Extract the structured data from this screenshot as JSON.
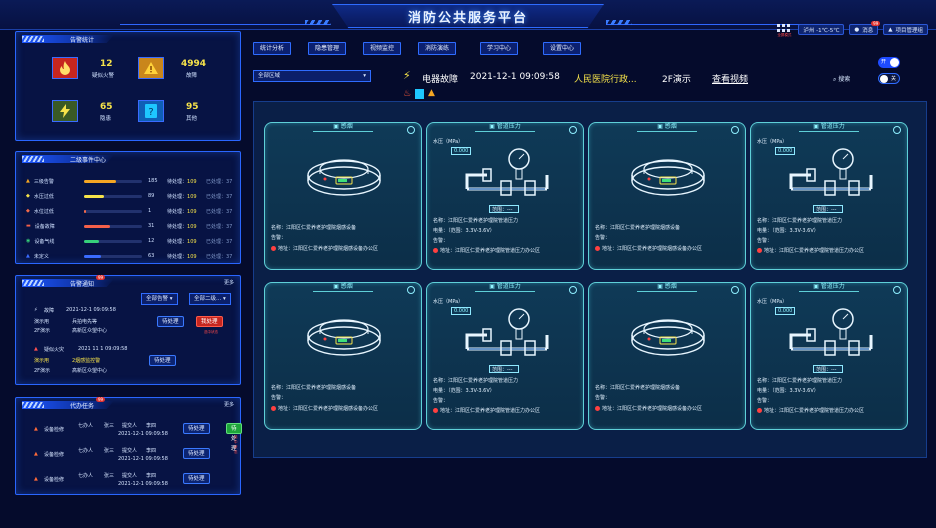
{
  "header": {
    "title": "消防公共服务平台",
    "weather": "泸州 -1℃-5℃",
    "messages": "消息",
    "message_badge": "99",
    "user": "项目管理组",
    "grid_badge_text": "全屏模式"
  },
  "alarm_stats": {
    "title": "告警统计",
    "items": [
      {
        "num": "12",
        "label": "疑似火警",
        "icon": "fire-icon"
      },
      {
        "num": "4994",
        "label": "故障",
        "icon": "warning-icon"
      },
      {
        "num": "65",
        "label": "隐患",
        "icon": "lightning-icon"
      },
      {
        "num": "95",
        "label": "其他",
        "icon": "question-icon"
      }
    ]
  },
  "second_center": {
    "title": "二级事件中心",
    "rows": [
      {
        "label": "三级告警",
        "count": "185",
        "pending": "109",
        "done": "已处理：37",
        "fill": 0.55,
        "color": "#f5a623"
      },
      {
        "label": "水压过低",
        "count": "89",
        "pending": "109",
        "done": "已处理：37",
        "fill": 0.35,
        "color": "#f6e34a"
      },
      {
        "label": "水位过低",
        "count": "1",
        "pending": "109",
        "done": "已处理：37",
        "fill": 0.04,
        "color": "#f56a4a"
      },
      {
        "label": "设备故障",
        "count": "31",
        "pending": "109",
        "done": "已处理：37",
        "fill": 0.45,
        "color": "#f5604a"
      },
      {
        "label": "设备气线",
        "count": "12",
        "pending": "109",
        "done": "已处理：37",
        "fill": 0.25,
        "color": "#36d07a"
      },
      {
        "label": "未定义",
        "count": "63",
        "pending": "109",
        "done": "已处理：37",
        "fill": 0.3,
        "color": "#3a6bff"
      }
    ],
    "pending_label": "待处理：",
    "col_label": "待处理："
  },
  "alarm_notice": {
    "title": "告警通知",
    "badge": "99",
    "more": "更多",
    "filter1": "全部告警",
    "filter2": "全部二级...",
    "items": [
      {
        "type": "故障",
        "time": "2021-12-1  09:09:58",
        "line2": "演示用",
        "line2b": "兵拍电先等",
        "line3": "2F演示",
        "line3b": "高新区众望中心",
        "btn": "待处理",
        "btn2": "我处理",
        "note": "选中状态"
      },
      {
        "type": "疑似火灾",
        "time": "2021 11 1  09:09:58",
        "line2": "演示用",
        "line2b": "2烟感监控警",
        "line3": "2F演示",
        "line3b": "高新区众望中心",
        "btn": "待处理"
      }
    ]
  },
  "todo": {
    "title": "代办任务",
    "badge": "99",
    "more": "更多",
    "items": [
      {
        "name": "设备检修",
        "p1": "七办人",
        "v1": "张三",
        "p2": "提交人",
        "v2": "李四",
        "time": "2021-12-1  09:09:58",
        "btn": "待处理",
        "btn2": "待处理",
        "note": "选中状态"
      },
      {
        "name": "设备检修",
        "p1": "七办人",
        "v1": "张三",
        "p2": "提交人",
        "v2": "李四",
        "time": "2021-12-1  09:09:58",
        "btn": "待处理"
      },
      {
        "name": "设备检修",
        "p1": "七办人",
        "v1": "张三",
        "p2": "提交人",
        "v2": "李四",
        "time": "2021-12-1  09:09:58",
        "btn": "待处理"
      }
    ]
  },
  "nav": {
    "tabs": [
      "统计分析",
      "隐患管理",
      "视频监控",
      "消防演练",
      "学习中心",
      "设置中心"
    ],
    "region": "全部区域",
    "event_type": "电器故障",
    "event_time": "2021-12-1  09:09:58",
    "event_place": "人民医院行政...",
    "event_floor": "2F演示",
    "video_link": "查看视频",
    "search": "搜索",
    "toggle_on": "开",
    "toggle_off": "关"
  },
  "cards": {
    "smoke": {
      "title": "感烟",
      "name": "名称：江阳区仁爱养老护理院烟感设备",
      "alarm": "告警：",
      "addr": "地址：江阳区仁爱养老护理院烟感设备办公区"
    },
    "pressure": {
      "title": "管道压力",
      "unit": "水压（MPa）",
      "value": "0.000",
      "range": "范围：---",
      "name": "名称：江阳区仁爱养老护理院管道压力",
      "power": "电量：（范围：3.3V-3.6V）",
      "alarm": "告警：",
      "addr": "地址：江阳区仁爱养老护理院管道压力办公区"
    }
  },
  "colors": {
    "accent": "#2f6cff",
    "card_border": "#5fd0d8",
    "warn": "#f6e34a",
    "danger": "#e0312e",
    "ok": "#1ea63b"
  }
}
